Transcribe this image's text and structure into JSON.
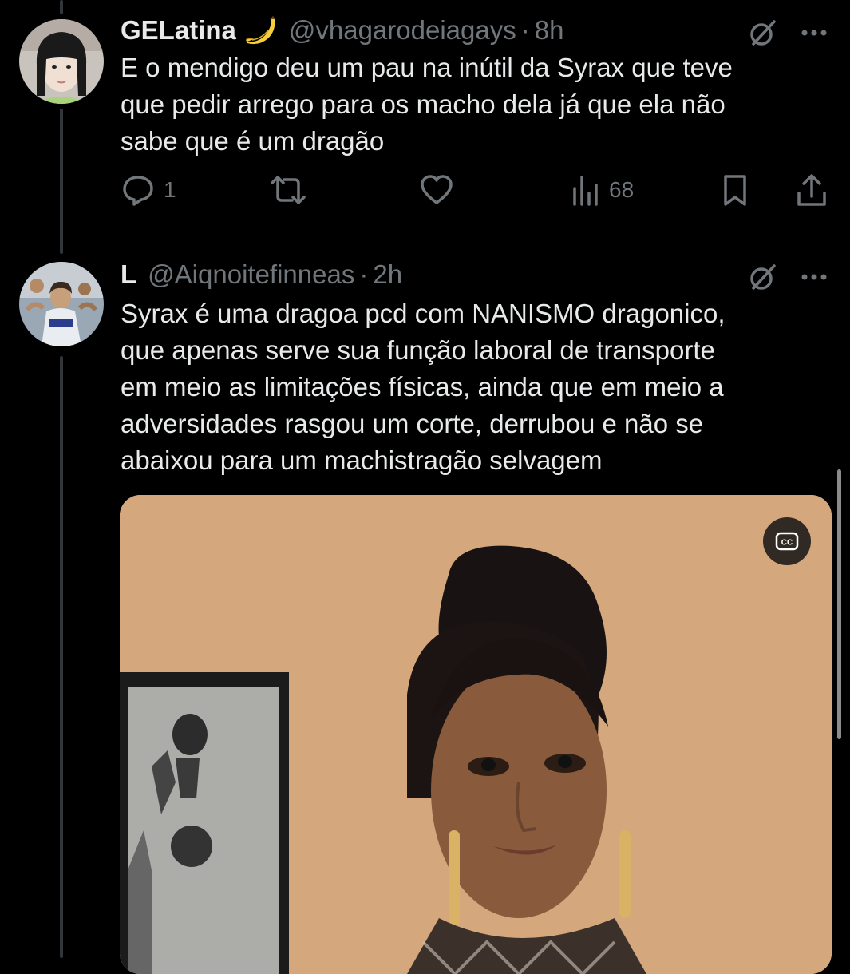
{
  "tweet1": {
    "display_name": "GELatina",
    "emoji": "banana",
    "handle": "@vhagarodeiagays",
    "separator": "·",
    "time": "8h",
    "text": "E o mendigo deu um pau na inútil da Syrax que teve\nque pedir arrego para os macho dela já que ela não\nsabe que é um dragão",
    "actions": {
      "reply_count": "1",
      "retweet_count": "",
      "like_count": "",
      "views_count": "68"
    }
  },
  "tweet2": {
    "display_name": "L",
    "handle": "@Aiqnoitefinneas",
    "separator": "·",
    "time": "2h",
    "text": "Syrax é uma dragoa pcd com NANISMO dragonico,\nque apenas serve sua função laboral de transporte\nem meio as limitações físicas, ainda que em meio a\nadversidades rasgou um corte, derrubou e não se\nabaixou para um machistragão selvagem",
    "media": {
      "cc_label": "CC"
    }
  },
  "icons": {
    "reply": "reply-icon",
    "retweet": "retweet-icon",
    "like": "heart-icon",
    "views": "views-icon",
    "bookmark": "bookmark-icon",
    "share": "share-icon",
    "grok": "grok-icon",
    "more": "more-icon"
  },
  "colors": {
    "background": "#000000",
    "text": "#e7e9ea",
    "muted": "#71767b",
    "thread_line": "#333639"
  }
}
